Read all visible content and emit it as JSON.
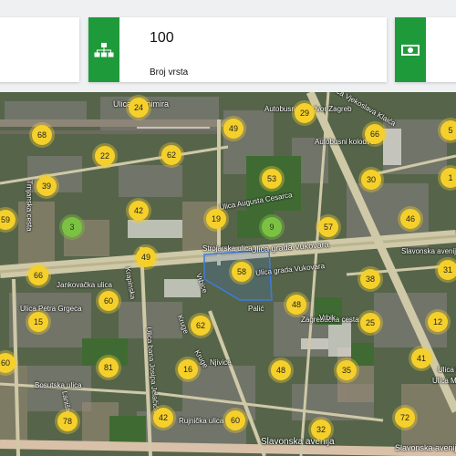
{
  "cards": {
    "middle": {
      "value": "100",
      "label": "Broj vrsta",
      "icon": "hierarchy-icon",
      "color": "#1f9a3a"
    },
    "right": {
      "icon": "banknote-icon",
      "color": "#1f9a3a"
    }
  },
  "map": {
    "street_labels": [
      "Ulica Branimira",
      "Autobusni kolodvor Zagreb",
      "Autobusni kolodvor",
      "Ulica grada Vukovara",
      "Strojarska ulica",
      "Ulica grada Vukovara",
      "Jankovačka ulica",
      "Ulica Petra Grgeca",
      "Bosutska ulica",
      "Rujnička ulica",
      "Slavonska avenija",
      "Slavonska avenija",
      "Njivice",
      "Krapinska",
      "Kruge",
      "Palić",
      "Trnjanska cesta",
      "Vrbice",
      "Ulica Augusta Cesarca",
      "Lanište",
      "Zagrebačka cesta",
      "Slavonska avenija",
      "Ulica Vjekoslava Klaića",
      "Vrbik",
      "Kruge",
      "Ulica bana Josipa Jelačića",
      "Ulica Ivana Lučića",
      "Ulica Marina Getaldića"
    ],
    "clusters": [
      {
        "count": "24",
        "color": "yellow"
      },
      {
        "count": "68",
        "color": "yellow"
      },
      {
        "count": "49",
        "color": "yellow"
      },
      {
        "count": "29",
        "color": "yellow"
      },
      {
        "count": "22",
        "color": "yellow"
      },
      {
        "count": "62",
        "color": "yellow"
      },
      {
        "count": "66",
        "color": "yellow"
      },
      {
        "count": "5",
        "color": "yellow"
      },
      {
        "count": "39",
        "color": "yellow"
      },
      {
        "count": "53",
        "color": "yellow"
      },
      {
        "count": "30",
        "color": "yellow"
      },
      {
        "count": "1",
        "color": "yellow"
      },
      {
        "count": "42",
        "color": "yellow"
      },
      {
        "count": "59",
        "color": "yellow"
      },
      {
        "count": "3",
        "color": "green"
      },
      {
        "count": "19",
        "color": "yellow"
      },
      {
        "count": "9",
        "color": "green"
      },
      {
        "count": "57",
        "color": "yellow"
      },
      {
        "count": "46",
        "color": "yellow"
      },
      {
        "count": "49",
        "color": "yellow"
      },
      {
        "count": "66",
        "color": "yellow"
      },
      {
        "count": "58",
        "color": "yellow"
      },
      {
        "count": "38",
        "color": "yellow"
      },
      {
        "count": "31",
        "color": "yellow"
      },
      {
        "count": "60",
        "color": "yellow"
      },
      {
        "count": "48",
        "color": "yellow"
      },
      {
        "count": "15",
        "color": "yellow"
      },
      {
        "count": "62",
        "color": "yellow"
      },
      {
        "count": "25",
        "color": "yellow"
      },
      {
        "count": "12",
        "color": "yellow"
      },
      {
        "count": "60",
        "color": "yellow"
      },
      {
        "count": "81",
        "color": "yellow"
      },
      {
        "count": "16",
        "color": "yellow"
      },
      {
        "count": "48",
        "color": "yellow"
      },
      {
        "count": "35",
        "color": "yellow"
      },
      {
        "count": "41",
        "color": "yellow"
      },
      {
        "count": "78",
        "color": "yellow"
      },
      {
        "count": "42",
        "color": "yellow"
      },
      {
        "count": "60",
        "color": "yellow"
      },
      {
        "count": "32",
        "color": "yellow"
      },
      {
        "count": "72",
        "color": "yellow"
      }
    ],
    "selection_outline_color": "#3d7be0"
  }
}
